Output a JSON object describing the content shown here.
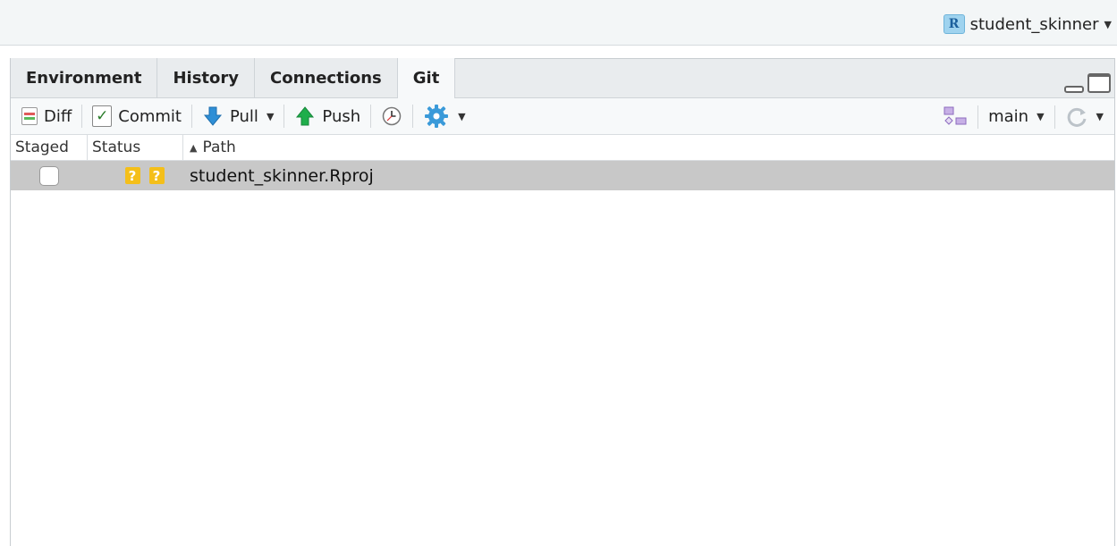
{
  "project": {
    "name": "student_skinner",
    "icon": "r-project-icon"
  },
  "tabs": [
    {
      "label": "Environment",
      "active": false
    },
    {
      "label": "History",
      "active": false
    },
    {
      "label": "Connections",
      "active": false
    },
    {
      "label": "Git",
      "active": true
    }
  ],
  "toolbar": {
    "diff_label": "Diff",
    "commit_label": "Commit",
    "pull_label": "Pull",
    "push_label": "Push",
    "branch_label": "main"
  },
  "table": {
    "columns": [
      "Staged",
      "Status",
      "Path"
    ],
    "sort_column": "Path",
    "rows": [
      {
        "staged": false,
        "status": [
          "?",
          "?"
        ],
        "path": "student_skinner.Rproj"
      }
    ]
  },
  "colors": {
    "status_badge": "#f4bf1a",
    "selected_row": "#c8c8c8",
    "pull_arrow": "#2f8fd6",
    "push_arrow": "#1fae4b"
  }
}
